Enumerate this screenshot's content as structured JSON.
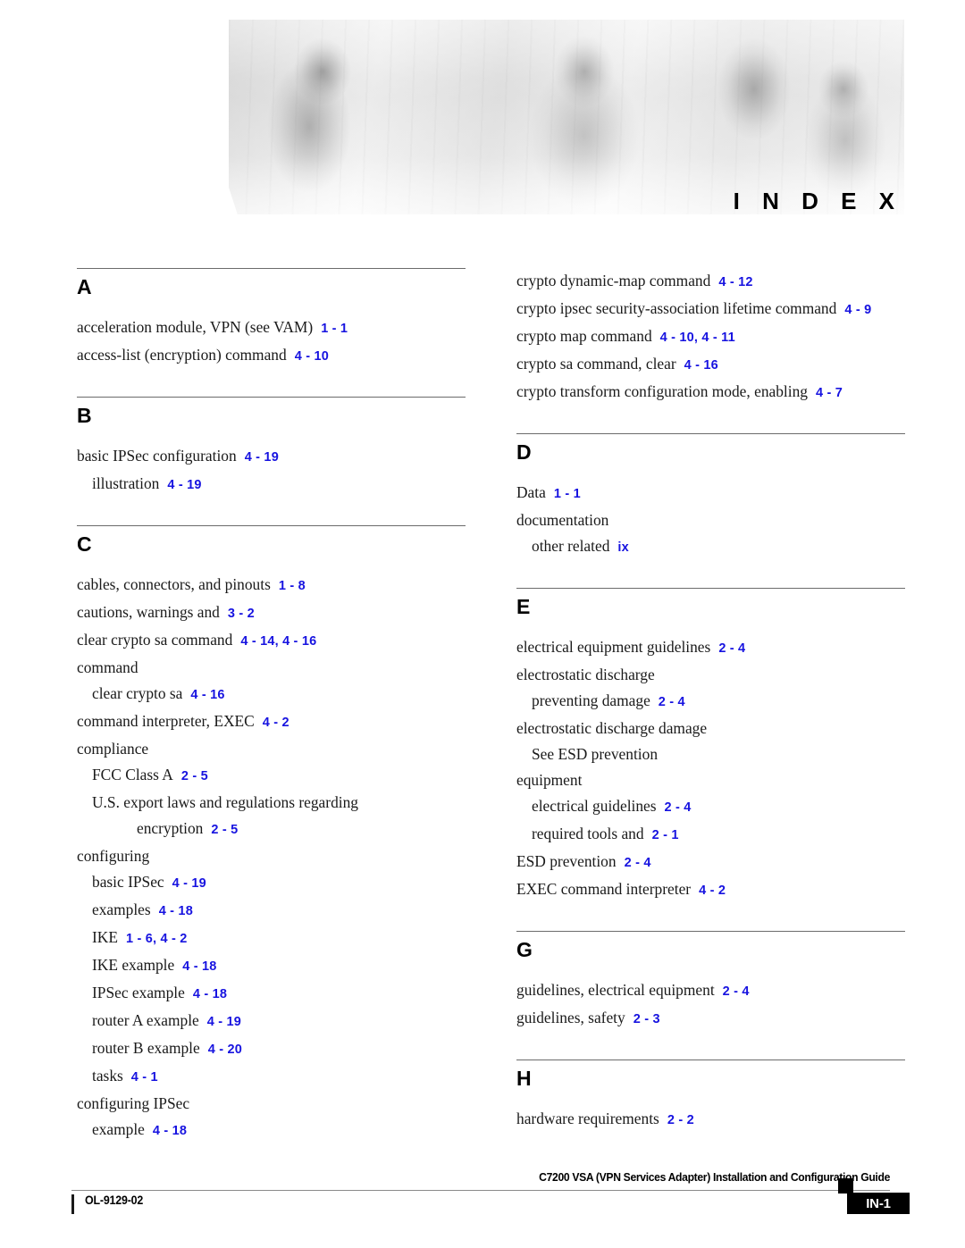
{
  "header": {
    "banner_title": "I N D E X",
    "banner_image_name": "cisco-people-banner-photo"
  },
  "columns": [
    {
      "id": "left",
      "sections": [
        {
          "letter": "A",
          "entries": [
            {
              "level": 1,
              "text": "acceleration module, VPN (see VAM)",
              "ref": "1 - 1"
            },
            {
              "level": 1,
              "text": "access-list (encryption) command",
              "ref": "4 - 10"
            }
          ]
        },
        {
          "letter": "B",
          "entries": [
            {
              "level": 1,
              "text": "basic IPSec configuration",
              "ref": "4 - 19"
            },
            {
              "level": 2,
              "text": "illustration",
              "ref": "4 - 19"
            }
          ]
        },
        {
          "letter": "C",
          "entries": [
            {
              "level": 1,
              "text": "cables, connectors, and pinouts",
              "ref": "1 - 8"
            },
            {
              "level": 1,
              "text": "cautions, warnings and",
              "ref": "3 - 2"
            },
            {
              "level": 1,
              "text": "clear crypto sa command",
              "ref": "4 - 14, 4 - 16"
            },
            {
              "level": 1,
              "text": "command",
              "ref": ""
            },
            {
              "level": 2,
              "text": "clear crypto sa",
              "ref": "4 - 16"
            },
            {
              "level": 1,
              "text": "command interpreter, EXEC",
              "ref": "4 - 2"
            },
            {
              "level": 1,
              "text": "compliance",
              "ref": ""
            },
            {
              "level": 2,
              "text": "FCC Class A",
              "ref": "2 - 5"
            },
            {
              "level": 2,
              "wrapped": true,
              "text": "U.S. export laws and regulations regarding",
              "continuation": "encryption",
              "ref": "2 - 5"
            },
            {
              "level": 1,
              "text": "configuring",
              "ref": ""
            },
            {
              "level": 2,
              "text": "basic IPSec",
              "ref": "4 - 19"
            },
            {
              "level": 2,
              "text": "examples",
              "ref": "4 - 18"
            },
            {
              "level": 2,
              "text": "IKE",
              "ref": "1 - 6, 4 - 2"
            },
            {
              "level": 2,
              "text": "IKE example",
              "ref": "4 - 18"
            },
            {
              "level": 2,
              "text": "IPSec example",
              "ref": "4 - 18"
            },
            {
              "level": 2,
              "text": "router A example",
              "ref": "4 - 19"
            },
            {
              "level": 2,
              "text": "router B example",
              "ref": "4 - 20"
            },
            {
              "level": 2,
              "text": "tasks",
              "ref": "4 - 1"
            },
            {
              "level": 1,
              "text": "configuring IPSec",
              "ref": ""
            },
            {
              "level": 2,
              "text": "example",
              "ref": "4 - 18"
            }
          ]
        }
      ]
    },
    {
      "id": "right",
      "sections": [
        {
          "letter": "",
          "entries": [
            {
              "level": 1,
              "text": "crypto dynamic-map command",
              "ref": "4 - 12"
            },
            {
              "level": 1,
              "text": "crypto ipsec security-association lifetime command",
              "ref": "4 - 9"
            },
            {
              "level": 1,
              "text": "crypto map command",
              "ref": "4 - 10, 4 - 11"
            },
            {
              "level": 1,
              "text": "crypto sa command, clear",
              "ref": "4 - 16"
            },
            {
              "level": 1,
              "text": "crypto transform configuration mode, enabling",
              "ref": "4 - 7"
            }
          ]
        },
        {
          "letter": "D",
          "entries": [
            {
              "level": 1,
              "text": "Data",
              "ref": "1 - 1"
            },
            {
              "level": 1,
              "text": "documentation",
              "ref": ""
            },
            {
              "level": 2,
              "text": "other related",
              "ref": "ix"
            }
          ]
        },
        {
          "letter": "E",
          "entries": [
            {
              "level": 1,
              "text": "electrical equipment guidelines",
              "ref": "2 - 4"
            },
            {
              "level": 1,
              "text": "electrostatic discharge",
              "ref": ""
            },
            {
              "level": 2,
              "text": "preventing damage",
              "ref": "2 - 4"
            },
            {
              "level": 1,
              "text": "electrostatic discharge damage",
              "ref": ""
            },
            {
              "level": 2,
              "text": "See ESD prevention",
              "ref": ""
            },
            {
              "level": 1,
              "text": "equipment",
              "ref": ""
            },
            {
              "level": 2,
              "text": "electrical guidelines",
              "ref": "2 - 4"
            },
            {
              "level": 2,
              "text": "required tools and",
              "ref": "2 - 1"
            },
            {
              "level": 1,
              "text": "ESD prevention",
              "ref": "2 - 4"
            },
            {
              "level": 1,
              "text": "EXEC command interpreter",
              "ref": "4 - 2"
            }
          ]
        },
        {
          "letter": "G",
          "entries": [
            {
              "level": 1,
              "text": "guidelines, electrical equipment",
              "ref": "2 - 4"
            },
            {
              "level": 1,
              "text": "guidelines, safety",
              "ref": "2 - 3"
            }
          ]
        },
        {
          "letter": "H",
          "entries": [
            {
              "level": 1,
              "text": "hardware requirements",
              "ref": "2 - 2"
            }
          ]
        }
      ]
    }
  ],
  "footer": {
    "title": "C7200 VSA (VPN Services Adapter) Installation and Configuration Guide",
    "doc_id": "OL-9129-02",
    "page_label": "IN-1"
  },
  "colors": {
    "reference_blue": "#1713e0",
    "rule_gray": "#6b6b6b",
    "footer_black": "#000000"
  }
}
